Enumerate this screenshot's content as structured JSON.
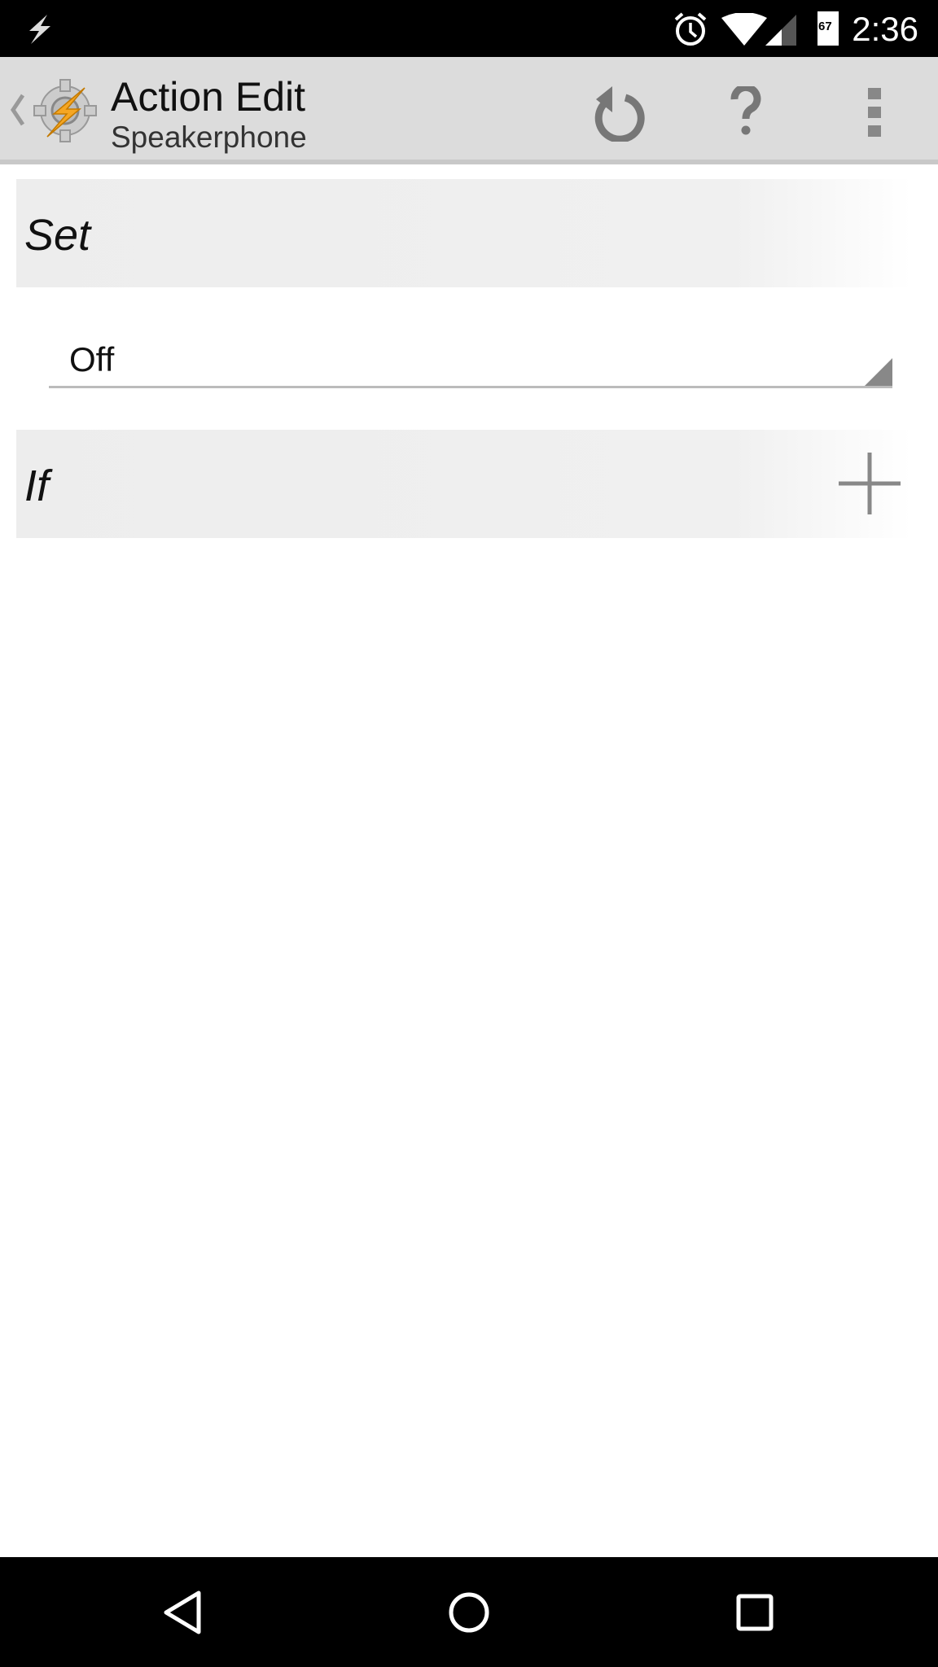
{
  "status_bar": {
    "time": "2:36",
    "battery": "67",
    "icons": [
      "tasker-notification-icon",
      "alarm-icon",
      "wifi-icon",
      "signal-icon",
      "battery-icon"
    ]
  },
  "action_bar": {
    "title": "Action Edit",
    "subtitle": "Speakerphone",
    "icons": [
      "back-chevron-icon",
      "tasker-app-icon",
      "undo-icon",
      "help-icon",
      "overflow-menu-icon"
    ]
  },
  "sections": {
    "set": {
      "label": "Set"
    },
    "if": {
      "label": "If"
    }
  },
  "set_dropdown": {
    "value": "Off"
  },
  "nav_bar": {
    "icons": [
      "back-icon",
      "home-icon",
      "recents-icon"
    ]
  }
}
